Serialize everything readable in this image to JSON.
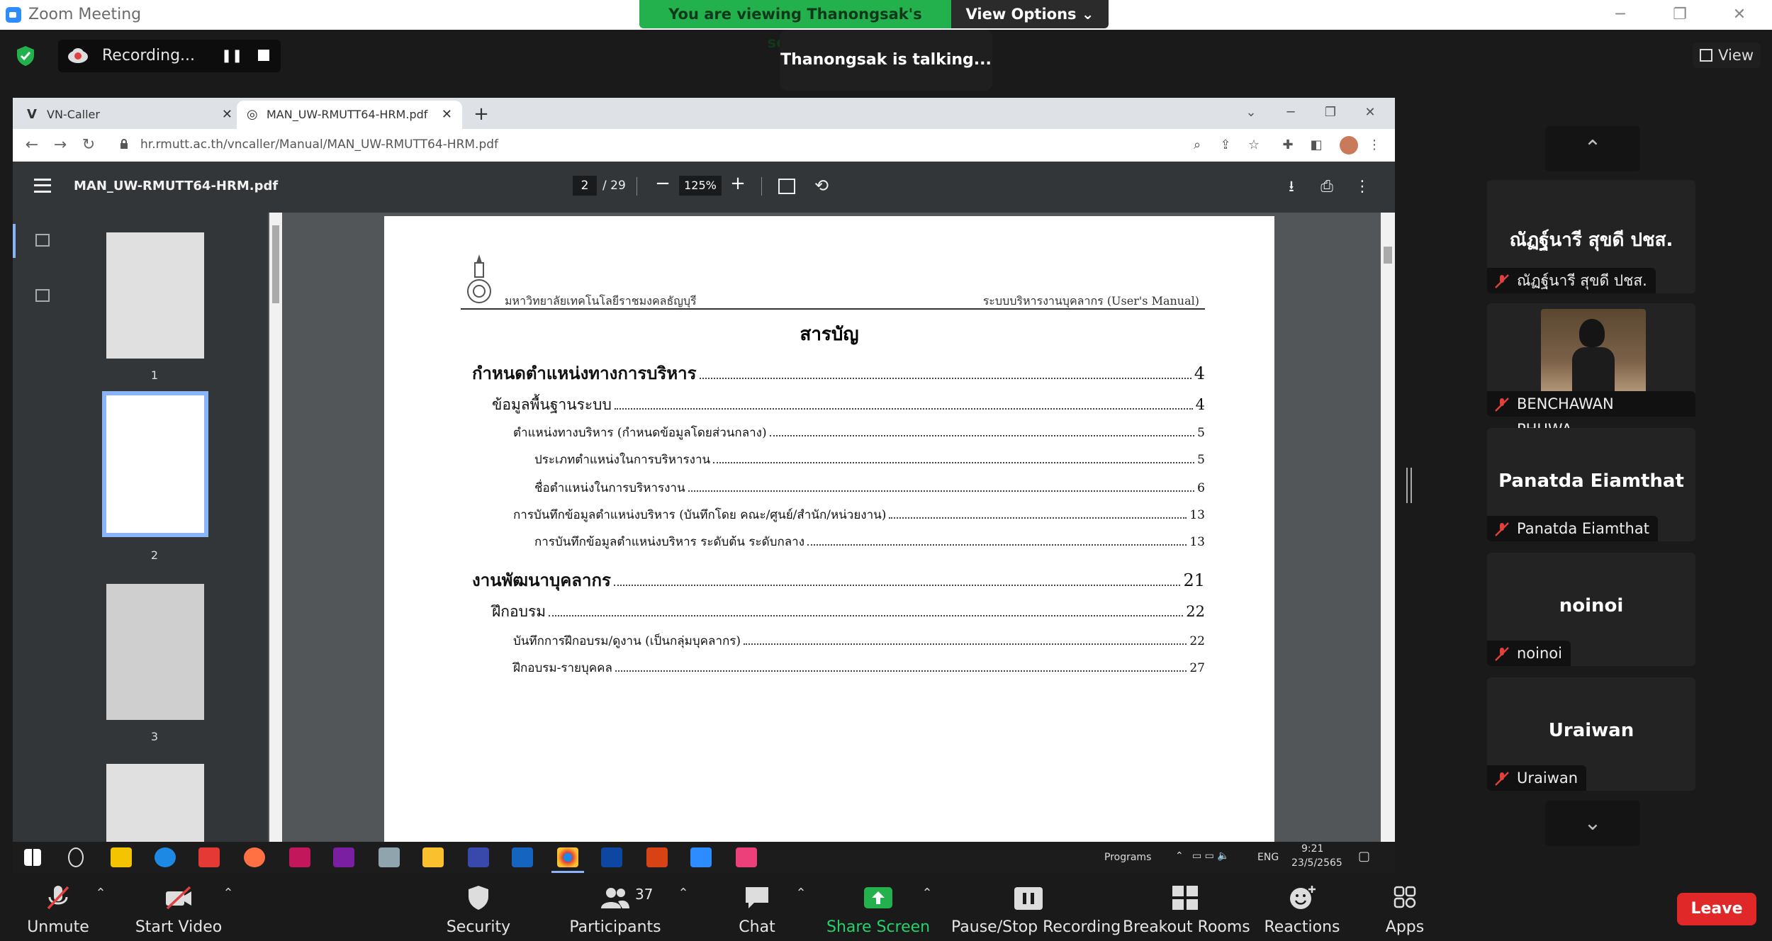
{
  "window": {
    "title": "Zoom Meeting"
  },
  "banner": {
    "viewing": "You are viewing Thanongsak's screen",
    "view_options": "View Options ⌄"
  },
  "recording": {
    "label": "Recording..."
  },
  "talking": {
    "text": "Thanongsak is talking..."
  },
  "view_button": {
    "label": "View"
  },
  "browser": {
    "tabs": [
      {
        "icon": "V",
        "label": "VN-Caller",
        "close": "✕"
      },
      {
        "icon": "◎",
        "label": "MAN_UW-RMUTT64-HRM.pdf",
        "close": "✕"
      }
    ],
    "url": "hr.rmutt.ac.th/vncaller/Manual/MAN_UW-RMUTT64-HRM.pdf"
  },
  "pdf": {
    "filename": "MAN_UW-RMUTT64-HRM.pdf",
    "current_page": "2",
    "total_pages": "/ 29",
    "zoom": "125%",
    "thumbnails": [
      "1",
      "2",
      "3"
    ],
    "header_left": "มหาวิทยาลัยเทคโนโลยีราชมงคลธัญบุรี",
    "header_right": "ระบบบริหารงานบุคลากร (User's Manual)",
    "toc_title": "สารบัญ",
    "toc": [
      {
        "text": "กำหนดตำแหน่งทางการบริหาร",
        "page": "4"
      },
      {
        "text": "ข้อมูลพื้นฐานระบบ",
        "page": "4"
      },
      {
        "text": "ตำแหน่งทางบริหาร (กำหนดข้อมูลโดยส่วนกลาง)",
        "page": "5"
      },
      {
        "text": "ประเภทตำแหน่งในการบริหารงาน",
        "page": "5"
      },
      {
        "text": "ชื่อตำแหน่งในการบริหารงาน",
        "page": "6"
      },
      {
        "text": "การบันทึกข้อมูลตำแหน่งบริหาร (บันทึกโดย คณะ/ศูนย์/สำนัก/หน่วยงาน)",
        "page": "13"
      },
      {
        "text": "การบันทึกข้อมูลตำแหน่งบริหาร ระดับต้น ระดับกลาง",
        "page": "13"
      },
      {
        "text": "งานพัฒนาบุคลากร",
        "page": "21"
      },
      {
        "text": "ฝึกอบรม",
        "page": "22"
      },
      {
        "text": "บันทึกการฝึกอบรม/ดูงาน (เป็นกลุ่มบุคลากร)",
        "page": "22"
      },
      {
        "text": "ฝึกอบรม-รายบุคคล",
        "page": "27"
      }
    ]
  },
  "taskbar": {
    "programs": "Programs",
    "lang": "ENG",
    "time": "9:21",
    "date": "23/5/2565"
  },
  "participants": [
    {
      "big": "ณัฏฐ์นารี สุขดี ปชส.",
      "small": "ณัฏฐ์นารี สุขดี ปชส."
    },
    {
      "big": "",
      "small": "BENCHAWAN PHUWA..."
    },
    {
      "big": "Panatda Eiamthat",
      "small": "Panatda Eiamthat"
    },
    {
      "big": "noinoi",
      "small": "noinoi"
    },
    {
      "big": "Uraiwan",
      "small": "Uraiwan"
    }
  ],
  "toolbar": {
    "unmute": "Unmute",
    "start_video": "Start Video",
    "security": "Security",
    "participants": "Participants",
    "participants_count": "37",
    "chat": "Chat",
    "share_screen": "Share Screen",
    "pause_stop": "Pause/Stop Recording",
    "breakout": "Breakout Rooms",
    "reactions": "Reactions",
    "apps": "Apps",
    "leave": "Leave"
  },
  "colors": {
    "accent_green": "#22b14c",
    "leave_red": "#e02828",
    "mic_off_red": "#e04040"
  }
}
